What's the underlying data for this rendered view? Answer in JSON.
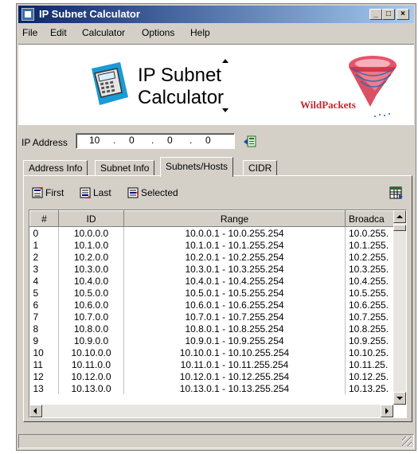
{
  "window": {
    "title": "IP Subnet Calculator"
  },
  "titlebar_buttons": {
    "minimize": "_",
    "maximize": "□",
    "close": "×"
  },
  "menu": [
    {
      "label": "File"
    },
    {
      "label": "Edit"
    },
    {
      "label": "Calculator"
    },
    {
      "label": "Options"
    },
    {
      "label": "Help"
    }
  ],
  "banner": {
    "line1": "IP Subnet",
    "line2": "Calculator",
    "logo_text": "WildPackets"
  },
  "ip_address": {
    "label": "IP Address",
    "octets": [
      "10",
      "0",
      "0",
      "0"
    ]
  },
  "tabs": [
    {
      "label": "Address Info"
    },
    {
      "label": "Subnet Info"
    },
    {
      "label": "Subnets/Hosts"
    },
    {
      "label": "CIDR"
    }
  ],
  "toolbar": {
    "first": "First",
    "last": "Last",
    "selected": "Selected"
  },
  "table": {
    "columns": [
      "#",
      "ID",
      "Range",
      "Broadca"
    ],
    "rows": [
      [
        "0",
        "10.0.0.0",
        "10.0.0.1 - 10.0.255.254",
        "10.0.255."
      ],
      [
        "1",
        "10.1.0.0",
        "10.1.0.1 - 10.1.255.254",
        "10.1.255."
      ],
      [
        "2",
        "10.2.0.0",
        "10.2.0.1 - 10.2.255.254",
        "10.2.255."
      ],
      [
        "3",
        "10.3.0.0",
        "10.3.0.1 - 10.3.255.254",
        "10.3.255."
      ],
      [
        "4",
        "10.4.0.0",
        "10.4.0.1 - 10.4.255.254",
        "10.4.255."
      ],
      [
        "5",
        "10.5.0.0",
        "10.5.0.1 - 10.5.255.254",
        "10.5.255."
      ],
      [
        "6",
        "10.6.0.0",
        "10.6.0.1 - 10.6.255.254",
        "10.6.255."
      ],
      [
        "7",
        "10.7.0.0",
        "10.7.0.1 - 10.7.255.254",
        "10.7.255."
      ],
      [
        "8",
        "10.8.0.0",
        "10.8.0.1 - 10.8.255.254",
        "10.8.255."
      ],
      [
        "9",
        "10.9.0.0",
        "10.9.0.1 - 10.9.255.254",
        "10.9.255."
      ],
      [
        "10",
        "10.10.0.0",
        "10.10.0.1 - 10.10.255.254",
        "10.10.25."
      ],
      [
        "11",
        "10.11.0.0",
        "10.11.0.1 - 10.11.255.254",
        "10.11.25."
      ],
      [
        "12",
        "10.12.0.0",
        "10.12.0.1 - 10.12.255.254",
        "10.12.25."
      ],
      [
        "13",
        "10.13.0.0",
        "10.13.0.1 - 10.13.255.254",
        "10.13.25."
      ]
    ]
  },
  "colors": {
    "titlebar_start": "#0a246a",
    "titlebar_end": "#a6caf0",
    "face": "#d4d0c8",
    "logo_red": "#c0282d"
  }
}
